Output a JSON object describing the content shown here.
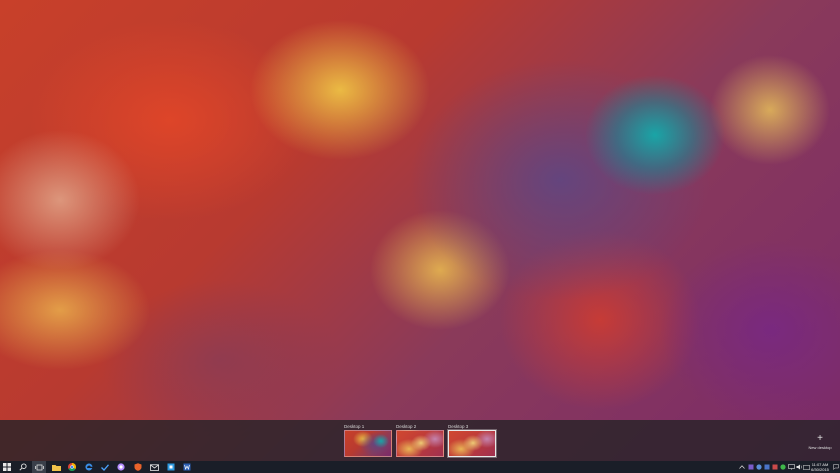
{
  "desktop": {
    "wallpaper": "fractal-swirl"
  },
  "virtual_desktops": {
    "items": [
      {
        "label": "Desktop 1",
        "active": false
      },
      {
        "label": "Desktop 2",
        "active": false
      },
      {
        "label": "Desktop 3",
        "active": true
      }
    ],
    "new_desktop_label": "New desktop",
    "new_desktop_icon": "plus-icon"
  },
  "taskbar": {
    "background_color": "#1a1e28",
    "pinned": [
      {
        "name": "start",
        "icon": "windows-logo-icon"
      },
      {
        "name": "search",
        "icon": "search-icon"
      },
      {
        "name": "task-view",
        "icon": "task-view-icon"
      },
      {
        "name": "file-explorer",
        "icon": "folder-icon"
      },
      {
        "name": "chrome",
        "icon": "chrome-icon"
      },
      {
        "name": "edge",
        "icon": "edge-icon"
      },
      {
        "name": "todo",
        "icon": "checkmark-icon"
      },
      {
        "name": "app",
        "icon": "circle-app-icon"
      },
      {
        "name": "app",
        "icon": "shield-app-icon"
      },
      {
        "name": "mail",
        "icon": "mail-icon"
      },
      {
        "name": "app",
        "icon": "blue-app-icon"
      },
      {
        "name": "word",
        "icon": "word-icon"
      }
    ],
    "clock": {
      "time": "11:07 AM",
      "date": "6/30/2015"
    }
  }
}
